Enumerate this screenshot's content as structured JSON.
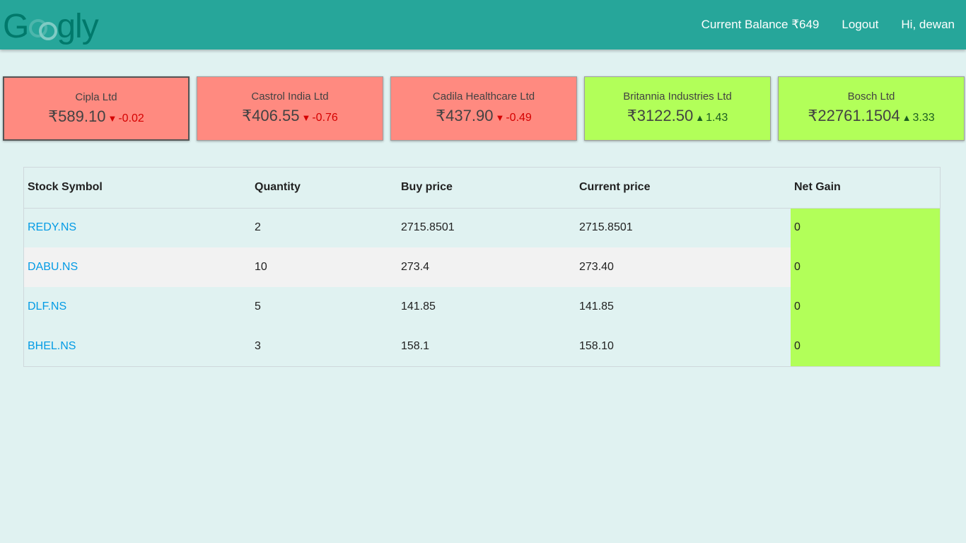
{
  "header": {
    "logo_text": [
      "G",
      "gly"
    ],
    "balance": "Current Balance ₹649",
    "logout": "Logout",
    "greeting": "Hi, dewan",
    "colors": {
      "bar": "#26a69a",
      "logo": "#00796b"
    }
  },
  "tickers": [
    {
      "name": "Cipla Ltd",
      "price": "₹589.10",
      "arrow": "▼",
      "change": "-0.02",
      "trend": "down"
    },
    {
      "name": "Castrol India Ltd",
      "price": "₹406.55",
      "arrow": "▼",
      "change": "-0.76",
      "trend": "down"
    },
    {
      "name": "Cadila Healthcare Ltd",
      "price": "₹437.90",
      "arrow": "▼",
      "change": "-0.49",
      "trend": "down"
    },
    {
      "name": "Britannia Industries Ltd",
      "price": "₹3122.50",
      "arrow": "▲",
      "change": "1.43",
      "trend": "up"
    },
    {
      "name": "Bosch Ltd",
      "price": "₹22761.1504",
      "arrow": "▲",
      "change": "3.33",
      "trend": "up"
    }
  ],
  "ticker_colors": {
    "down": "#ff8a80",
    "up": "#b2ff59"
  },
  "portfolio": {
    "columns": [
      "Stock Symbol",
      "Quantity",
      "Buy price",
      "Current price",
      "Net Gain"
    ],
    "rows": [
      {
        "symbol": "REDY.NS",
        "quantity": "2",
        "buy": "2715.8501",
        "current": "2715.8501",
        "gain": "0"
      },
      {
        "symbol": "DABU.NS",
        "quantity": "10",
        "buy": "273.4",
        "current": "273.40",
        "gain": "0"
      },
      {
        "symbol": "DLF.NS",
        "quantity": "5",
        "buy": "141.85",
        "current": "141.85",
        "gain": "0"
      },
      {
        "symbol": "BHEL.NS",
        "quantity": "3",
        "buy": "158.1",
        "current": "158.10",
        "gain": "0"
      }
    ]
  }
}
